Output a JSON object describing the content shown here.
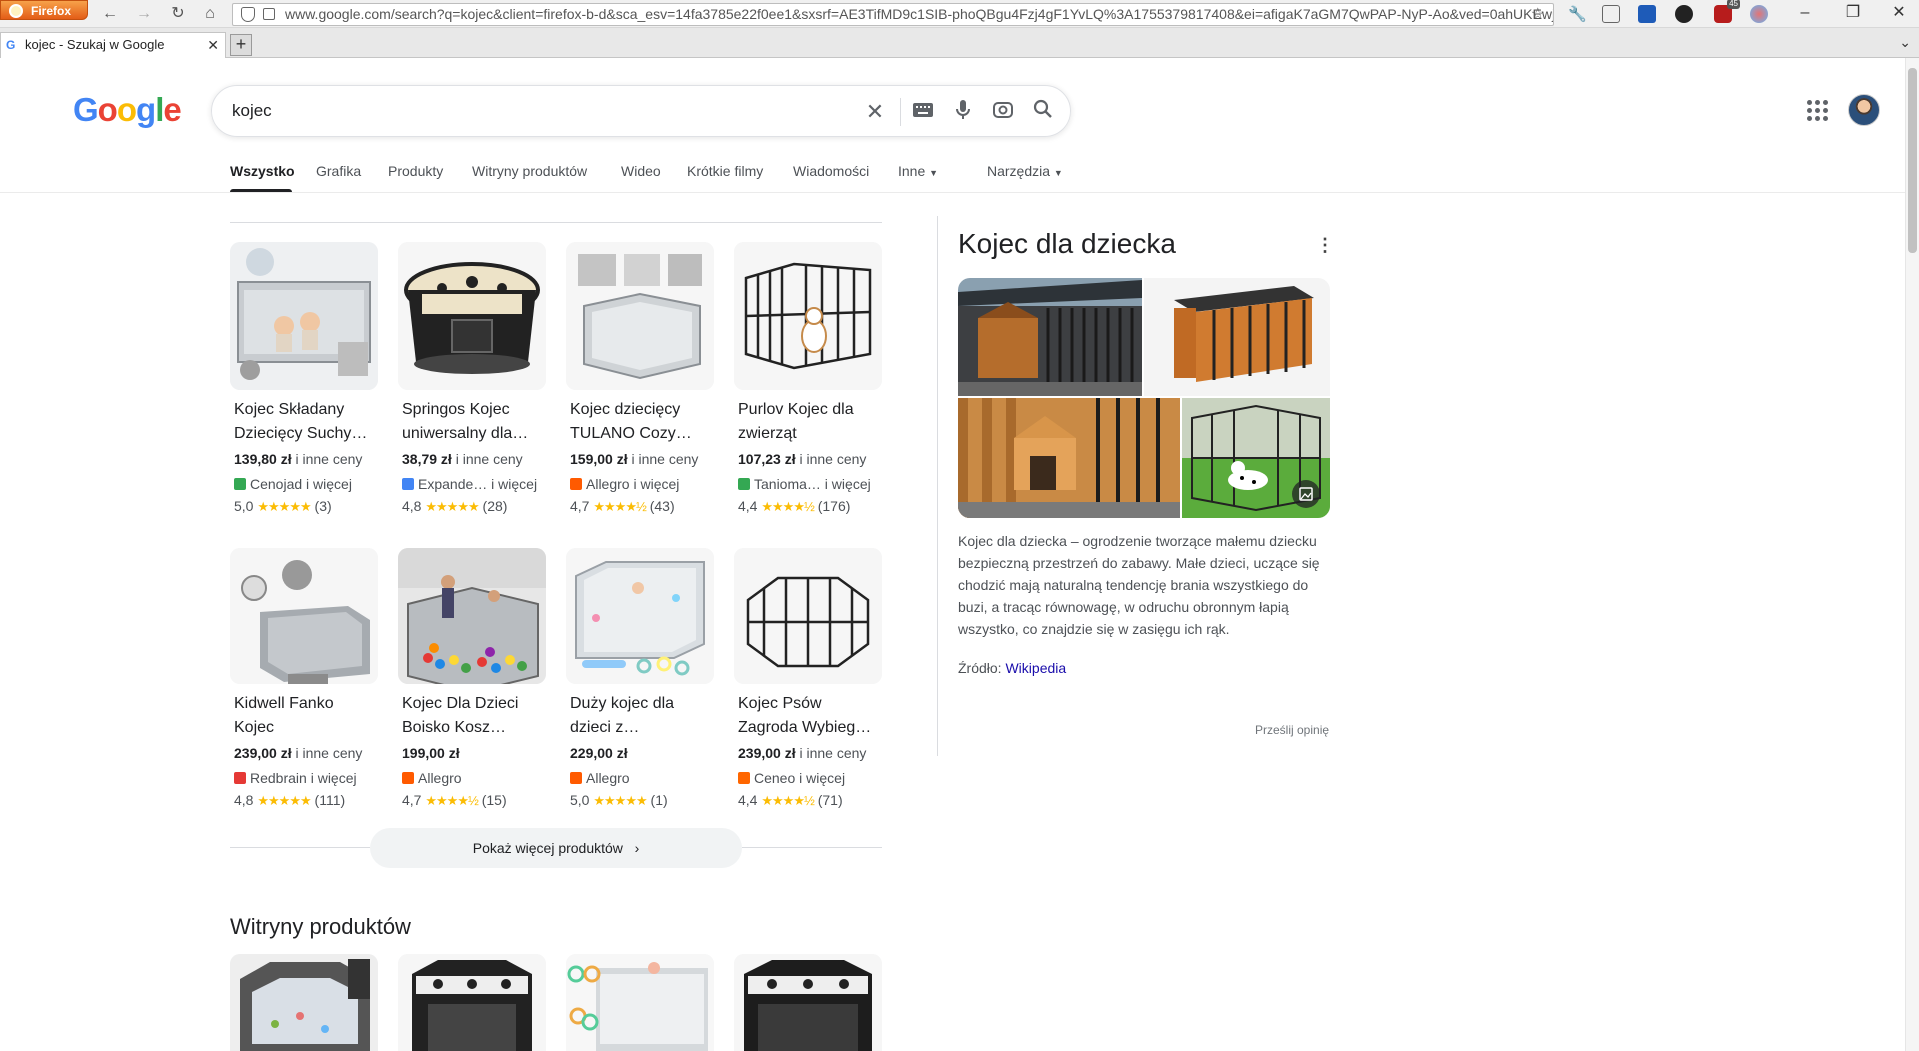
{
  "browser": {
    "app_name": "Firefox",
    "url": "www.google.com/search?q=kojec&client=firefox-b-d&sca_esv=14fa3785e22f0ee1&sxsrf=AE3TifMD9c1SIB-phoQBgu4Fzj4gF1YvLQ%3A1755379817408&ei=afigaK7aGM7QwPAP-NyP-Ao&ved=0ahUKEwju",
    "tab_title": "kojec - Szukaj w Google",
    "new_tab": "+",
    "notif_badge": "45"
  },
  "google": {
    "logo_letters": [
      "G",
      "o",
      "o",
      "g",
      "l",
      "e"
    ],
    "search_query": "kojec"
  },
  "tabs": {
    "all": "Wszystko",
    "images": "Grafika",
    "products": "Produkty",
    "product_sites": "Witryny produktów",
    "video": "Wideo",
    "short_videos": "Krótkie filmy",
    "news": "Wiadomości",
    "more": "Inne",
    "tools": "Narzędzia"
  },
  "products": [
    {
      "title": "Kojec Składany Dziecięcy Suchy…",
      "price": "139,80 zł",
      "price_suffix": "i inne ceny",
      "store": "Cenojad i więcej",
      "store_color": "#34a853",
      "rating": "5,0",
      "stars": "★★★★★",
      "reviews": "(3)"
    },
    {
      "title": "Springos Kojec uniwersalny dla…",
      "price": "38,79 zł",
      "price_suffix": "i inne ceny",
      "store": "Expande…  i więcej",
      "store_color": "#4285f4",
      "rating": "4,8",
      "stars": "★★★★★",
      "reviews": "(28)"
    },
    {
      "title": "Kojec dziecięcy TULANO Cozy…",
      "price": "159,00 zł",
      "price_suffix": "i inne ceny",
      "store": "Allegro i więcej",
      "store_color": "#ff5a00",
      "rating": "4,7",
      "stars": "★★★★½",
      "reviews": "(43)"
    },
    {
      "title": "Purlov Kojec dla zwierząt",
      "price": "107,23 zł",
      "price_suffix": "i inne ceny",
      "store": "Tanioma…  i więcej",
      "store_color": "#34a853",
      "rating": "4,4",
      "stars": "★★★★½",
      "reviews": "(176)"
    },
    {
      "title": "Kidwell Fanko Kojec",
      "price": "239,00 zł",
      "price_suffix": "i inne ceny",
      "store": "Redbrain i więcej",
      "store_color": "#e53935",
      "rating": "4,8",
      "stars": "★★★★★",
      "reviews": "(111)"
    },
    {
      "title": "Kojec Dla Dzieci Boisko Kosz…",
      "price": "199,00 zł",
      "price_suffix": "",
      "store": "Allegro",
      "store_color": "#ff5a00",
      "rating": "4,7",
      "stars": "★★★★½",
      "reviews": "(15)"
    },
    {
      "title": "Duży kojec dla dzieci z…",
      "price": "229,00 zł",
      "price_suffix": "",
      "store": "Allegro",
      "store_color": "#ff5a00",
      "rating": "5,0",
      "stars": "★★★★★",
      "reviews": "(1)"
    },
    {
      "title": "Kojec Psów Zagroda Wybieg…",
      "price": "239,00 zł",
      "price_suffix": "i inne ceny",
      "store": "Ceneo i więcej",
      "store_color": "#ff6600",
      "rating": "4,4",
      "stars": "★★★★½",
      "reviews": "(71)"
    }
  ],
  "more_products": "Pokaż więcej produktów",
  "product_sites_title": "Witryny produktów",
  "knowledge_panel": {
    "title": "Kojec dla dziecka",
    "description": "Kojec dla dziecka – ogrodzenie tworzące małemu dziecku bezpieczną przestrzeń do zabawy. Małe dzieci, uczące się chodzić mają naturalną tendencję brania wszystkiego do buzi, a tracąc równowagę, w odruchu obronnym łapią wszystko, co znajdzie się w zasięgu ich rąk.",
    "source_label": "Źródło:",
    "source_link": "Wikipedia",
    "feedback": "Prześlij opinię"
  }
}
